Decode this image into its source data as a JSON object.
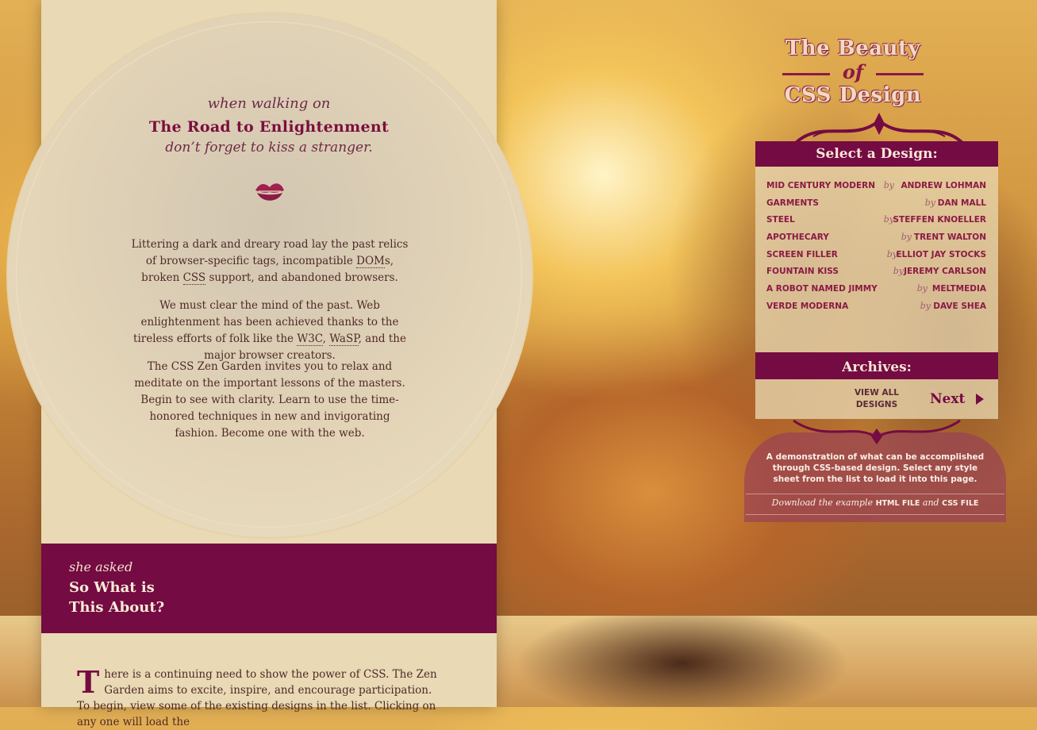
{
  "intro": {
    "pre": "when walking on",
    "title": "The Road to Enlightenment",
    "post": "don’t forget to kiss a stranger."
  },
  "paragraphs": [
    [
      "Littering a dark and dreary road lay the past relics of browser-specific tags, incompatible ",
      "DOM",
      "s, broken ",
      "CSS",
      " support, and abandoned browsers."
    ],
    [
      "We must clear the mind of the past. Web enlightenment has been achieved thanks to the tireless efforts of folk like the ",
      "W3C",
      ", ",
      "WaSP",
      ", and the major browser creators."
    ],
    [
      "The CSS Zen Garden invites you to relax and meditate on the important lessons of the masters. Begin to see with clarity. Learn to use the time-honored techniques in new and invigorating fashion. Become one with the web."
    ]
  ],
  "about": {
    "pre": "she asked",
    "title_line1": "So What is",
    "title_line2": "This About?",
    "dropcap": "T",
    "text": "here is a continuing need to show the power of CSS. The Zen Garden aims to excite, inspire, and encourage participation. To begin, view some of the existing designs in the list. Clicking on any one will load the"
  },
  "logo": {
    "line1": "The Beauty",
    "line2": "of",
    "line3": "CSS Design"
  },
  "select": {
    "heading": "Select a Design:",
    "by_label": "by",
    "designs": [
      {
        "name": "MID CENTURY MODERN",
        "author": "ANDREW LOHMAN"
      },
      {
        "name": "GARMENTS",
        "author": "DAN MALL"
      },
      {
        "name": "STEEL",
        "author": "STEFFEN KNOELLER"
      },
      {
        "name": "APOTHECARY",
        "author": "TRENT WALTON"
      },
      {
        "name": "SCREEN FILLER",
        "author": "ELLIOT JAY STOCKS"
      },
      {
        "name": "FOUNTAIN KISS",
        "author": "JEREMY CARLSON"
      },
      {
        "name": "A ROBOT NAMED JIMMY",
        "author": "MELTMEDIA"
      },
      {
        "name": "VERDE MODERNA",
        "author": "DAVE SHEA"
      }
    ]
  },
  "archives": {
    "heading": "Archives:",
    "view_all": "VIEW ALL DESIGNS",
    "next": "Next"
  },
  "demo": {
    "text": "A demonstration of what can be accomplished through CSS-based design. Select any style sheet from the list to load it into this page.",
    "download_prefix": "Download the example",
    "html_link": "HTML FILE",
    "and": "and",
    "css_link": "CSS FILE"
  },
  "colors": {
    "accent": "#740b42",
    "panel": "#e9d9b4",
    "text": "#4f2a28"
  },
  "icons": [
    "kiss-lips-icon",
    "next-arrow-icon",
    "ornament-flourish-icon"
  ]
}
